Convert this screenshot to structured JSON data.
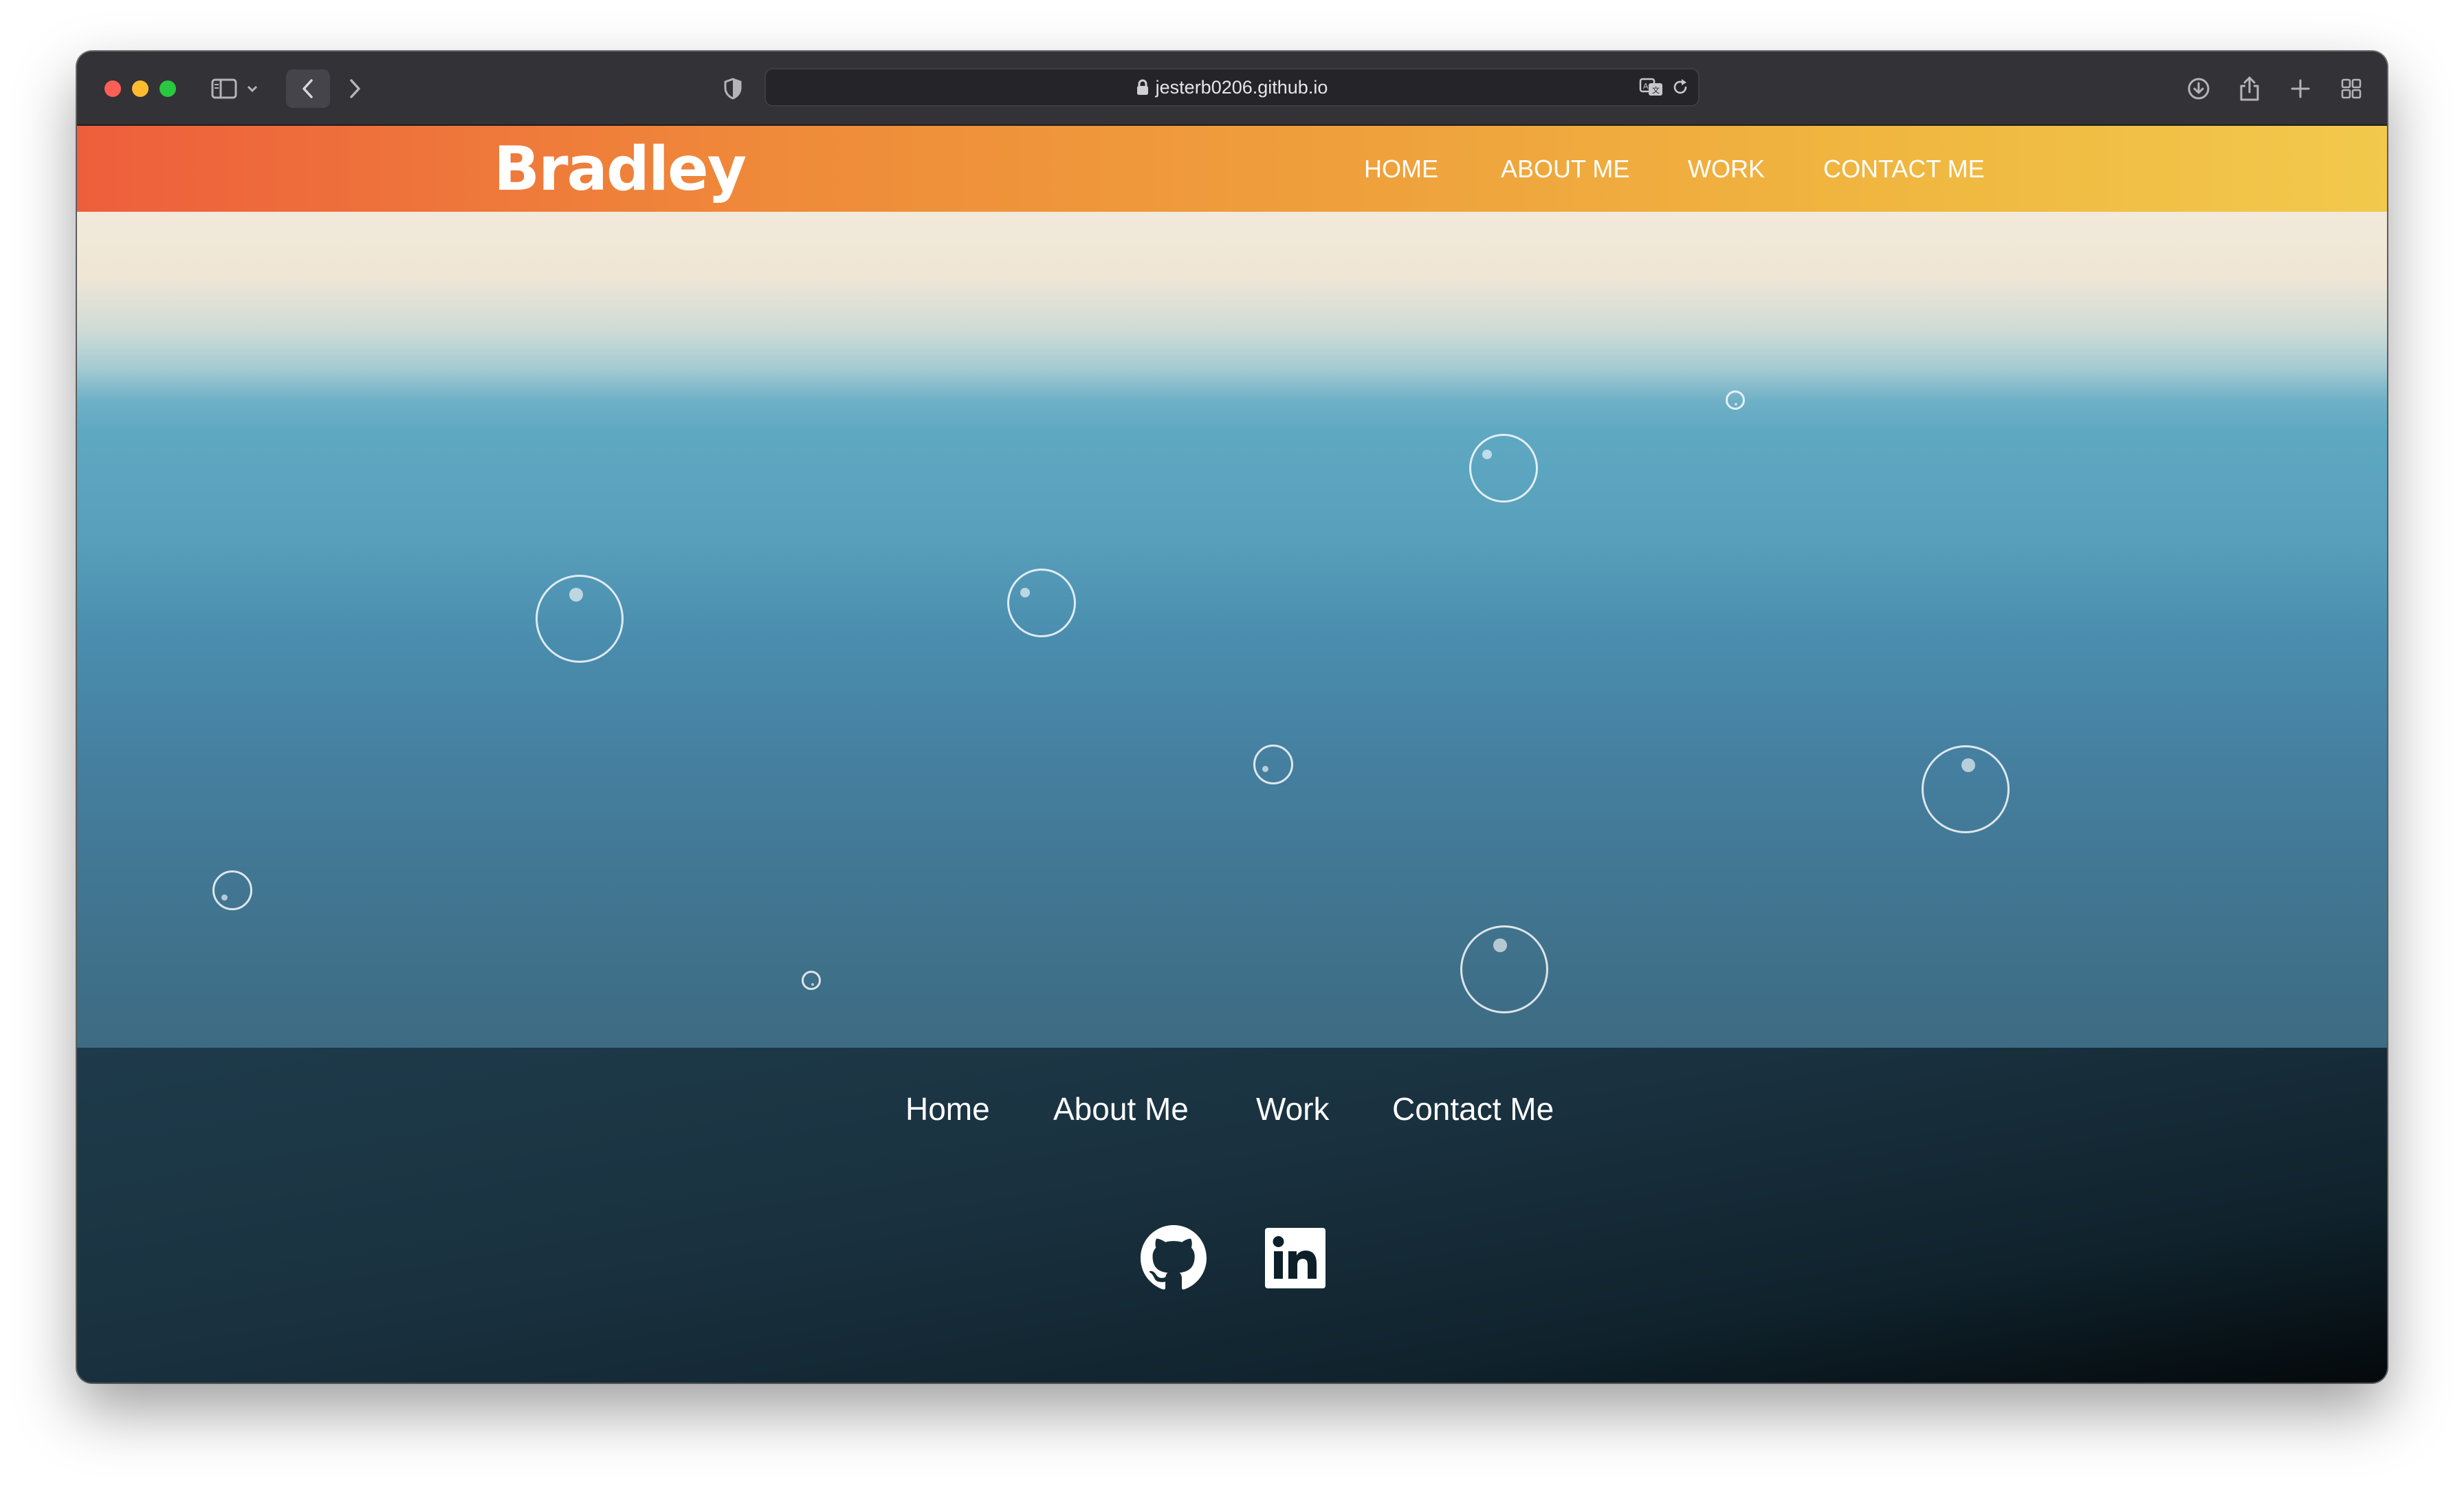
{
  "browser": {
    "url": "jesterb0206.github.io",
    "icons": {
      "sidebar": "sidebar-icon",
      "back": "chevron-left-icon",
      "forward": "chevron-right-icon",
      "privacy": "shield-icon",
      "secure": "lock-icon",
      "translate": "translate-icon",
      "reload": "reload-icon",
      "download": "download-icon",
      "share": "share-icon",
      "new_tab": "plus-icon",
      "tab_overview": "grid-icon"
    }
  },
  "site": {
    "brand": "Bradley",
    "nav": [
      "HOME",
      "ABOUT ME",
      "WORK",
      "CONTACT ME"
    ],
    "footer_nav": [
      "Home",
      "About Me",
      "Work",
      "Contact Me"
    ],
    "social": [
      "github-icon",
      "linkedin-icon"
    ],
    "colors": {
      "header_start": "#ee5e3c",
      "header_end": "#f2c94c",
      "hero_top": "#f1e9d9",
      "hero_bottom": "#3d6b83",
      "footer_start": "#1e3b4b",
      "footer_end": "#04090c"
    }
  }
}
